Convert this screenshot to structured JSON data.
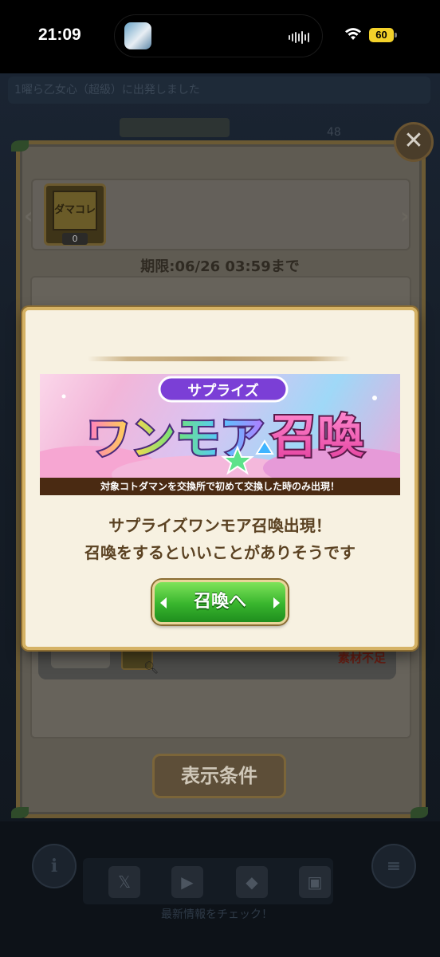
{
  "status_bar": {
    "time": "21:09",
    "battery": "60",
    "wifi_icon": "wifi-icon"
  },
  "background": {
    "notice": "1曜ら乙女心（超級）に出発しました",
    "stat_number": "48",
    "social_caption": "最新情報をチェック！",
    "info_label": "i",
    "x_label": "𝕏"
  },
  "exchange_panel": {
    "collection_label": "ダマコレ",
    "collection_count": "0",
    "deadline": "期限:06/26 03:59まで",
    "shortage_text": "素材不足",
    "display_button": "表示条件",
    "close_label": "✕"
  },
  "dialog": {
    "banner": {
      "tag": "サプライズ",
      "headline": "ワンモア召喚",
      "caption": "対象コトダマンを交換所で初めて交換した時のみ出現！"
    },
    "message_line1": "サプライズワンモア召喚出現！",
    "message_line2": "召喚をするといいことがありそうです",
    "summon_button": "召喚へ"
  },
  "colors": {
    "dialog_bg": "#f7f1e1",
    "dialog_border": "#d5b265",
    "button_green": "#38b52d",
    "message_text": "#5b4222"
  }
}
